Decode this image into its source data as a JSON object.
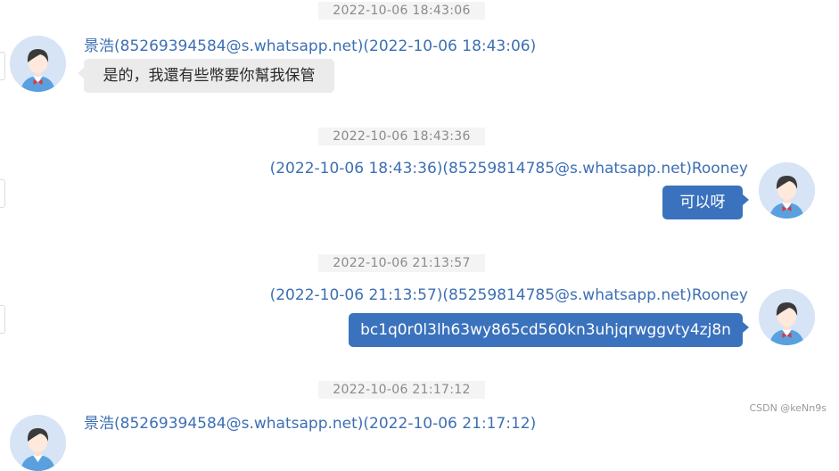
{
  "messages": [
    {
      "timestamp": "2022-10-06 18:43:06",
      "sender": "景浩(85269394584@s.whatsapp.net)(2022-10-06 18:43:06)",
      "text": "是的，我還有些幣要你幫我保管",
      "direction": "incoming"
    },
    {
      "timestamp": "2022-10-06 18:43:36",
      "sender": "(2022-10-06 18:43:36)(85259814785@s.whatsapp.net)Rooney",
      "text": "可以呀",
      "direction": "outgoing"
    },
    {
      "timestamp": "2022-10-06 21:13:57",
      "sender": "(2022-10-06 21:13:57)(85259814785@s.whatsapp.net)Rooney",
      "text": "bc1q0r0l3lh63wy865cd560kn3uhjqrwggvty4zj8n",
      "direction": "outgoing"
    },
    {
      "timestamp": "2022-10-06 21:17:12",
      "sender": "景浩(85269394584@s.whatsapp.net)(2022-10-06 21:17:12)",
      "text": "",
      "direction": "incoming"
    }
  ],
  "watermark": "CSDN @keNn9s",
  "colors": {
    "outgoing_bubble": "#3a72bd",
    "incoming_bubble": "#ebebeb",
    "sender_text": "#3d6fb3",
    "timestamp_bg": "#f4f4f4",
    "avatar_bg": "#d6e4f6"
  }
}
